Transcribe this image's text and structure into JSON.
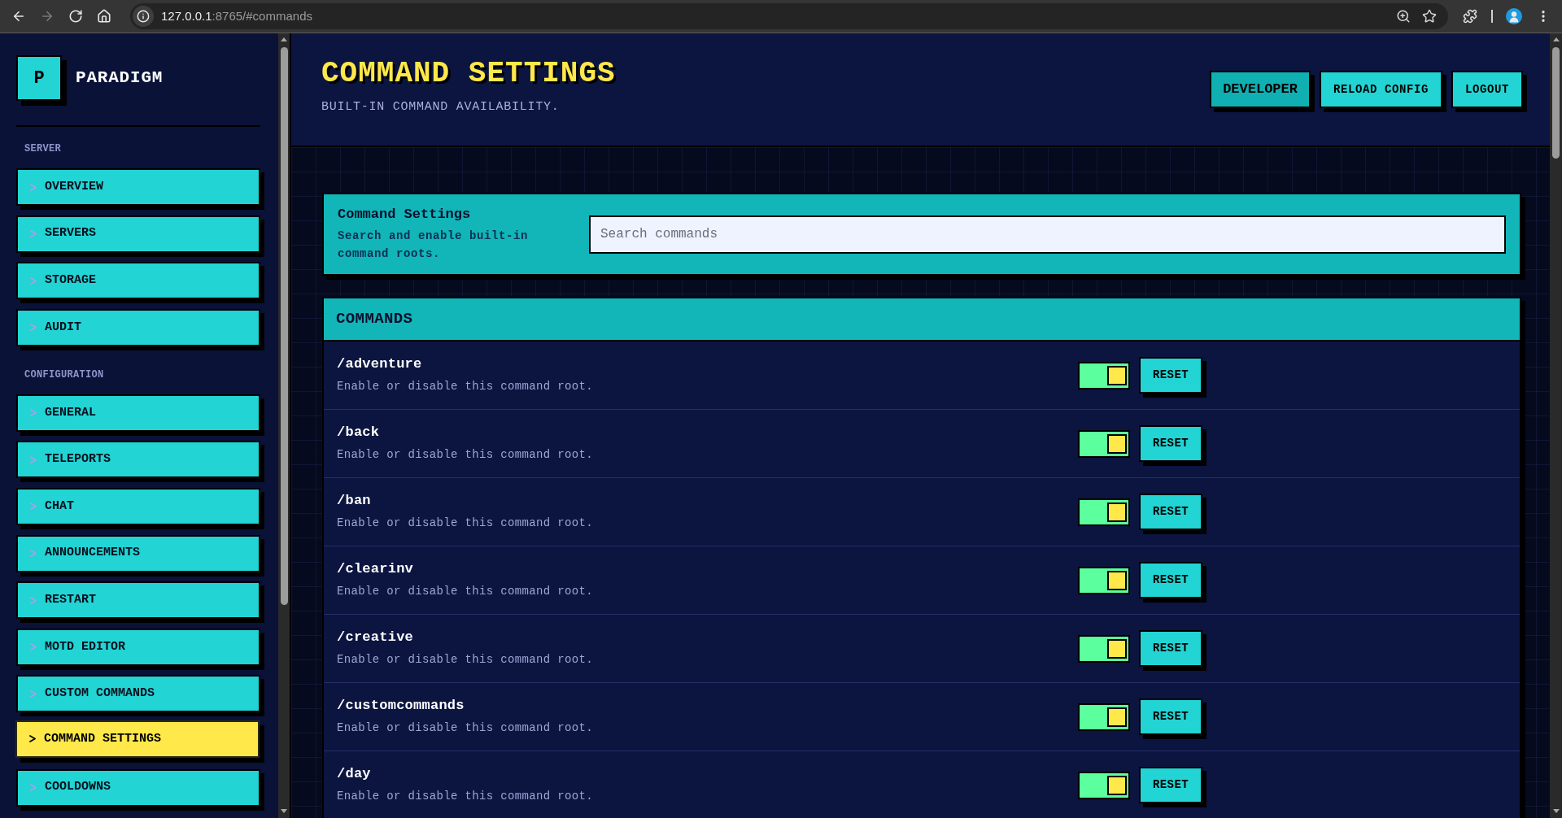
{
  "browser": {
    "forward_button": {
      "disabled": true
    },
    "url": {
      "host": "127.0.0.1",
      "path": ":8765/#commands"
    }
  },
  "sidebar": {
    "brand": {
      "letter": "P",
      "name": "PARADIGM"
    },
    "sections": [
      {
        "title": "SERVER",
        "items": [
          {
            "label": "OVERVIEW",
            "selected": false
          },
          {
            "label": "SERVERS",
            "selected": false
          },
          {
            "label": "STORAGE",
            "selected": false
          },
          {
            "label": "AUDIT",
            "selected": false
          }
        ]
      },
      {
        "title": "CONFIGURATION",
        "items": [
          {
            "label": "GENERAL",
            "selected": false
          },
          {
            "label": "TELEPORTS",
            "selected": false
          },
          {
            "label": "CHAT",
            "selected": false
          },
          {
            "label": "ANNOUNCEMENTS",
            "selected": false
          },
          {
            "label": "RESTART",
            "selected": false
          },
          {
            "label": "MOTD EDITOR",
            "selected": false
          },
          {
            "label": "CUSTOM COMMANDS",
            "selected": false
          },
          {
            "label": "COMMAND SETTINGS",
            "selected": true
          },
          {
            "label": "COOLDOWNS",
            "selected": false
          }
        ]
      }
    ]
  },
  "header": {
    "title": "COMMAND SETTINGS",
    "subtitle": "BUILT-IN COMMAND AVAILABILITY.",
    "buttons": [
      {
        "label": "DEVELOPER",
        "kind": "accent"
      },
      {
        "label": "RELOAD CONFIG",
        "kind": "plain"
      },
      {
        "label": "LOGOUT",
        "kind": "plain"
      }
    ]
  },
  "settings_card": {
    "title": "Command Settings",
    "description": "Search and enable built-in command roots.",
    "search": {
      "placeholder": "Search commands"
    }
  },
  "commands": {
    "title": "COMMANDS",
    "rows": [
      {
        "name": "/adventure",
        "description": "Enable or disable this command root.",
        "on": true,
        "reset_label": "RESET"
      },
      {
        "name": "/back",
        "description": "Enable or disable this command root.",
        "on": true,
        "reset_label": "RESET"
      },
      {
        "name": "/ban",
        "description": "Enable or disable this command root.",
        "on": true,
        "reset_label": "RESET"
      },
      {
        "name": "/clearinv",
        "description": "Enable or disable this command root.",
        "on": true,
        "reset_label": "RESET"
      },
      {
        "name": "/creative",
        "description": "Enable or disable this command root.",
        "on": true,
        "reset_label": "RESET"
      },
      {
        "name": "/customcommands",
        "description": "Enable or disable this command root.",
        "on": true,
        "reset_label": "RESET"
      },
      {
        "name": "/day",
        "description": "Enable or disable this command root.",
        "on": true,
        "reset_label": "RESET"
      }
    ]
  }
}
